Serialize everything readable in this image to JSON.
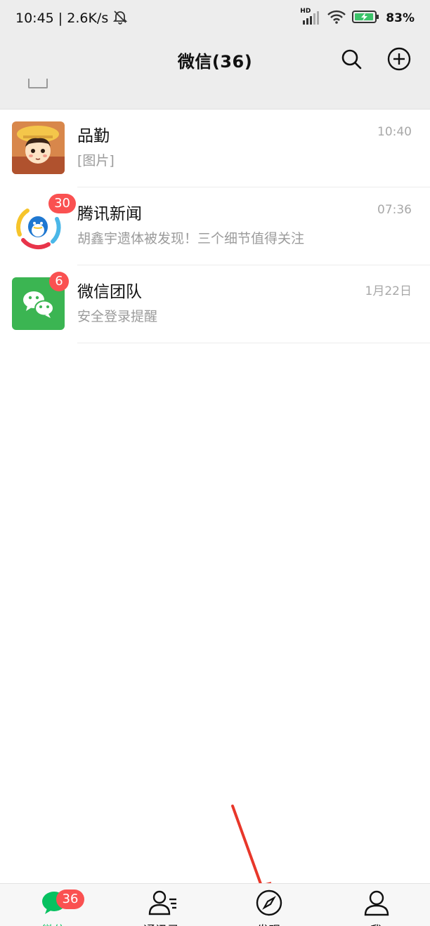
{
  "status_bar": {
    "time_speed": "10:45 | 2.6K/s",
    "hd": "HD",
    "battery_pct": "83%"
  },
  "header": {
    "title": "微信(36)"
  },
  "chats": [
    {
      "name": "品勤",
      "preview": "[图片]",
      "time": "10:40",
      "badge": ""
    },
    {
      "name": "腾讯新闻",
      "preview": "胡鑫宇遗体被发现！三个细节值得关注",
      "time": "07:36",
      "badge": "30"
    },
    {
      "name": "微信团队",
      "preview": "安全登录提醒",
      "time": "1月22日",
      "badge": "6"
    }
  ],
  "tabs": [
    {
      "label": "微信",
      "badge": "36"
    },
    {
      "label": "通讯录"
    },
    {
      "label": "发现"
    },
    {
      "label": "我"
    }
  ],
  "colors": {
    "accent": "#07c160",
    "badge": "#fa5151",
    "annotation": "#e8372a",
    "header_bg": "#ededed"
  }
}
